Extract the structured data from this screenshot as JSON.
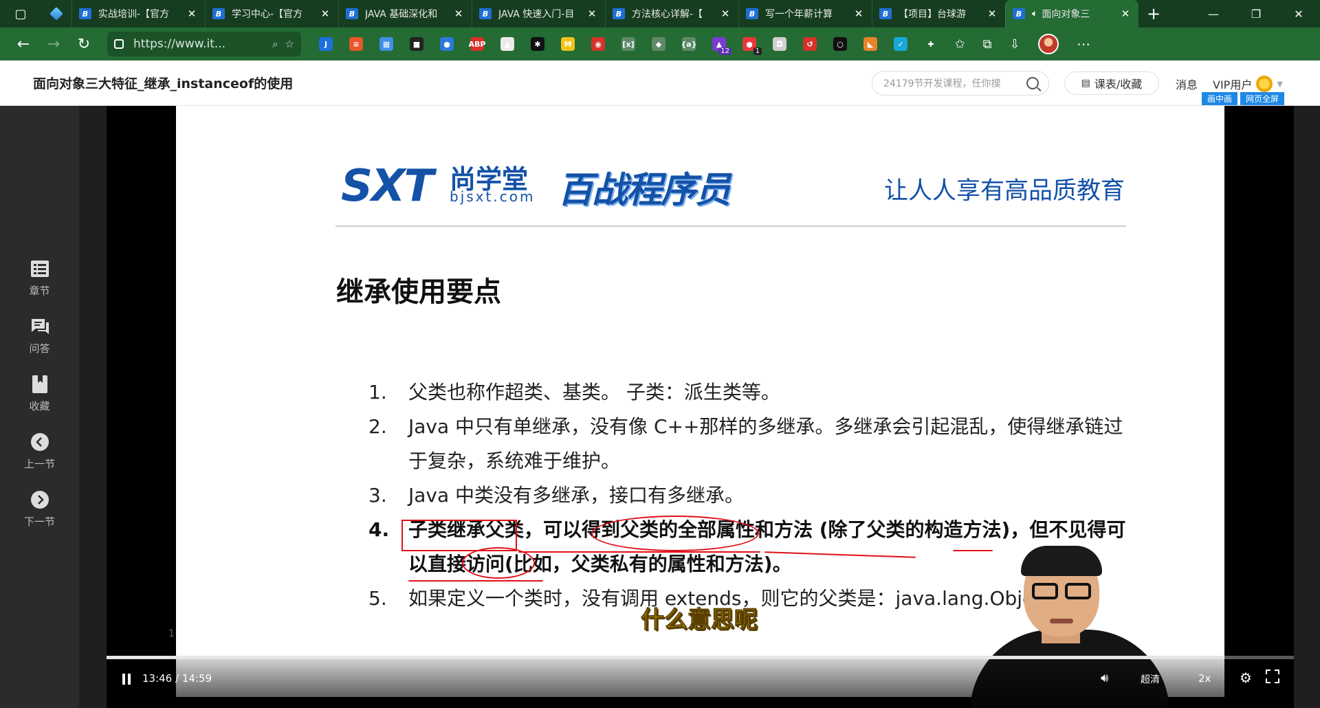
{
  "tabs": [
    {
      "title": "实战培训-【官方",
      "active": false
    },
    {
      "title": "学习中心-【官方",
      "active": false
    },
    {
      "title": "JAVA 基础深化和",
      "active": false
    },
    {
      "title": "JAVA 快速入门-目",
      "active": false
    },
    {
      "title": "方法核心详解-【",
      "active": false
    },
    {
      "title": "写一个年薪计算",
      "active": false
    },
    {
      "title": "【项目】台球游",
      "active": false
    },
    {
      "title": "面向对象三",
      "active": true
    }
  ],
  "address": {
    "url": "https://www.it..."
  },
  "extensions": [
    {
      "icon": "ext-j-icon",
      "text": "J",
      "color": "#1e6fe0"
    },
    {
      "icon": "ext-notes-icon",
      "text": "≡",
      "color": "#e8572a"
    },
    {
      "icon": "ext-grid-icon",
      "text": "▦",
      "color": "#3d8fe8"
    },
    {
      "icon": "ext-save-icon",
      "text": "■",
      "color": "#222222"
    },
    {
      "icon": "ext-pin-icon",
      "text": "●",
      "color": "#2a7bd8"
    },
    {
      "icon": "ext-abp-icon",
      "text": "ABP",
      "color": "#d6322a"
    },
    {
      "icon": "ext-mountain-icon",
      "text": "▲",
      "color": "#eaeaea"
    },
    {
      "icon": "ext-asterisk-icon",
      "text": "✱",
      "color": "#111111"
    },
    {
      "icon": "ext-m-icon",
      "text": "M",
      "color": "#f2c318"
    },
    {
      "icon": "ext-shield-icon",
      "text": "◉",
      "color": "#d6322a"
    },
    {
      "icon": "ext-bracket-icon",
      "text": "[x]",
      "color": "#5e8a6a"
    },
    {
      "icon": "ext-diamond-icon",
      "text": "◆",
      "color": "#5e8a6a"
    },
    {
      "icon": "ext-brace-icon",
      "text": "{a}",
      "color": "#5e8a6a"
    },
    {
      "icon": "ext-hat-icon",
      "text": "▲",
      "color": "#7b3bd0",
      "badge": "12"
    },
    {
      "icon": "ext-dice-icon",
      "text": "●",
      "color": "#e8383c",
      "badge": "1"
    },
    {
      "icon": "ext-camera-icon",
      "text": "◘",
      "color": "#cfcfcf"
    },
    {
      "icon": "ext-refresh-icon",
      "text": "↺",
      "color": "#d6322a"
    },
    {
      "icon": "ext-ring-icon",
      "text": "○",
      "color": "#111111"
    },
    {
      "icon": "ext-fox-icon",
      "text": "◣",
      "color": "#e8832a"
    },
    {
      "icon": "ext-check-shield-icon",
      "text": "✓",
      "color": "#1aa8d8"
    },
    {
      "icon": "ext-puzzle-icon",
      "text": "✚",
      "color": "#246b34"
    }
  ],
  "header": {
    "lesson_title": "面向对象三大特征_继承_instanceof的使用",
    "search_placeholder": "24179节开发课程，任你搜",
    "course_btn": "课表/收藏",
    "msg": "消息",
    "vip": "VIP用户",
    "pip": "画中画",
    "fullpage": "网页全屏"
  },
  "rail": [
    {
      "label": "章节",
      "icon": "chapter-icon"
    },
    {
      "label": "问答",
      "icon": "qa-icon"
    },
    {
      "label": "收藏",
      "icon": "bookmark-icon"
    },
    {
      "label": "上一节",
      "icon": "prev-icon"
    },
    {
      "label": "下一节",
      "icon": "next-icon"
    }
  ],
  "slide": {
    "logo_sxt": "SXT",
    "logo_cn": "尚学堂",
    "logo_url": "bjsxt.com",
    "logo_bz": "百战程序员",
    "slogan": "让人人享有高品质教育",
    "heading": "继承使用要点",
    "points": [
      {
        "num": "1.",
        "text": "父类也称作超类、基类。            子类：派生类等。"
      },
      {
        "num": "2.",
        "text": "Java 中只有单继承，没有像 C++那样的多继承。多继承会引起混乱，使得继承链过于复杂，系统难于维护。"
      },
      {
        "num": "3.",
        "text": "Java 中类没有多继承，接口有多继承。"
      },
      {
        "num": "4.",
        "text": "子类继承父类，可以得到父类的全部属性和方法 (除了父类的构造方法)，但不见得可以直接访问(比如，父类私有的属性和方法)。"
      },
      {
        "num": "5.",
        "text": "如果定义一个类时，没有调用 extends，则它的父类是：java.lang.Object。"
      }
    ],
    "subtitle": "什么意思呢",
    "stray": "1"
  },
  "player": {
    "time": "13:46 / 14:59",
    "progress": 0.9177,
    "quality": "超清",
    "speed": "2x"
  }
}
